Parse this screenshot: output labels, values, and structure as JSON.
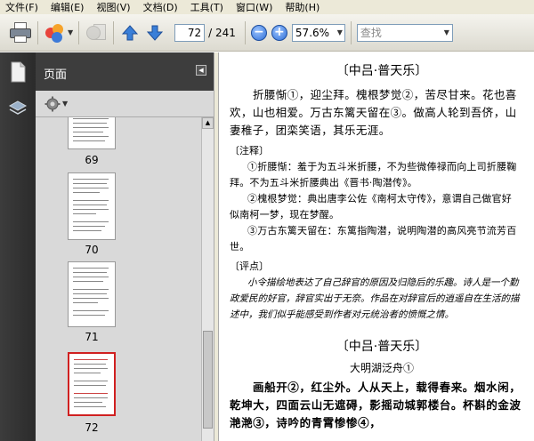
{
  "menu": [
    {
      "label": "文件(F)"
    },
    {
      "label": "编辑(E)"
    },
    {
      "label": "视图(V)"
    },
    {
      "label": "文档(D)"
    },
    {
      "label": "工具(T)"
    },
    {
      "label": "窗口(W)"
    },
    {
      "label": "帮助(H)"
    }
  ],
  "toolbar": {
    "page_current": "72",
    "page_total": "/ 241",
    "zoom": "57.6%",
    "search_placeholder": "查找"
  },
  "panel": {
    "title": "页面",
    "thumbnails": [
      {
        "label": "69"
      },
      {
        "label": "70"
      },
      {
        "label": "71"
      },
      {
        "label": "72",
        "selected": true
      }
    ]
  },
  "document": {
    "title1": "〔中吕·普天乐〕",
    "poem1": "折腰惭①，迎尘拜。槐根梦觉②，苦尽甘来。花也喜欢，山也相爱。万古东篱天留在③。做高人轮到吾侪，山妻稚子，团栾笑语，其乐无涯。",
    "notes_head": "〔注释〕",
    "note1": "①折腰惭：羞于为五斗米折腰，不为些微俸禄而向上司折腰鞠拜。不为五斗米折腰典出《晋书·陶潜传》。",
    "note2": "②槐根梦觉：典出唐李公佐《南柯太守传》，意谓自己做官好似南柯一梦，现在梦醒。",
    "note3": "③万古东篱天留在：东篱指陶潜，说明陶潜的高风亮节流芳百世。",
    "comment_head": "〔评点〕",
    "comment": "小令描绘地表达了自己辞官的原因及归隐后的乐趣。诗人是一个勤政爱民的好官，辞官实出于无奈。作品在对辞官后的逍遥自在生活的描述中，我们似乎能感受到作者对元统治者的愤慨之情。",
    "title2": "〔中吕·普天乐〕",
    "subtitle2": "大明湖泛舟①",
    "poem2": "画船开②，红尘外。人从天上，载得春来。烟水闲，乾坤大，四面云山无遮碍，影摇动城郭楼台。杯斟的金波滟滟③，诗吟的青霄惨惨④，"
  }
}
